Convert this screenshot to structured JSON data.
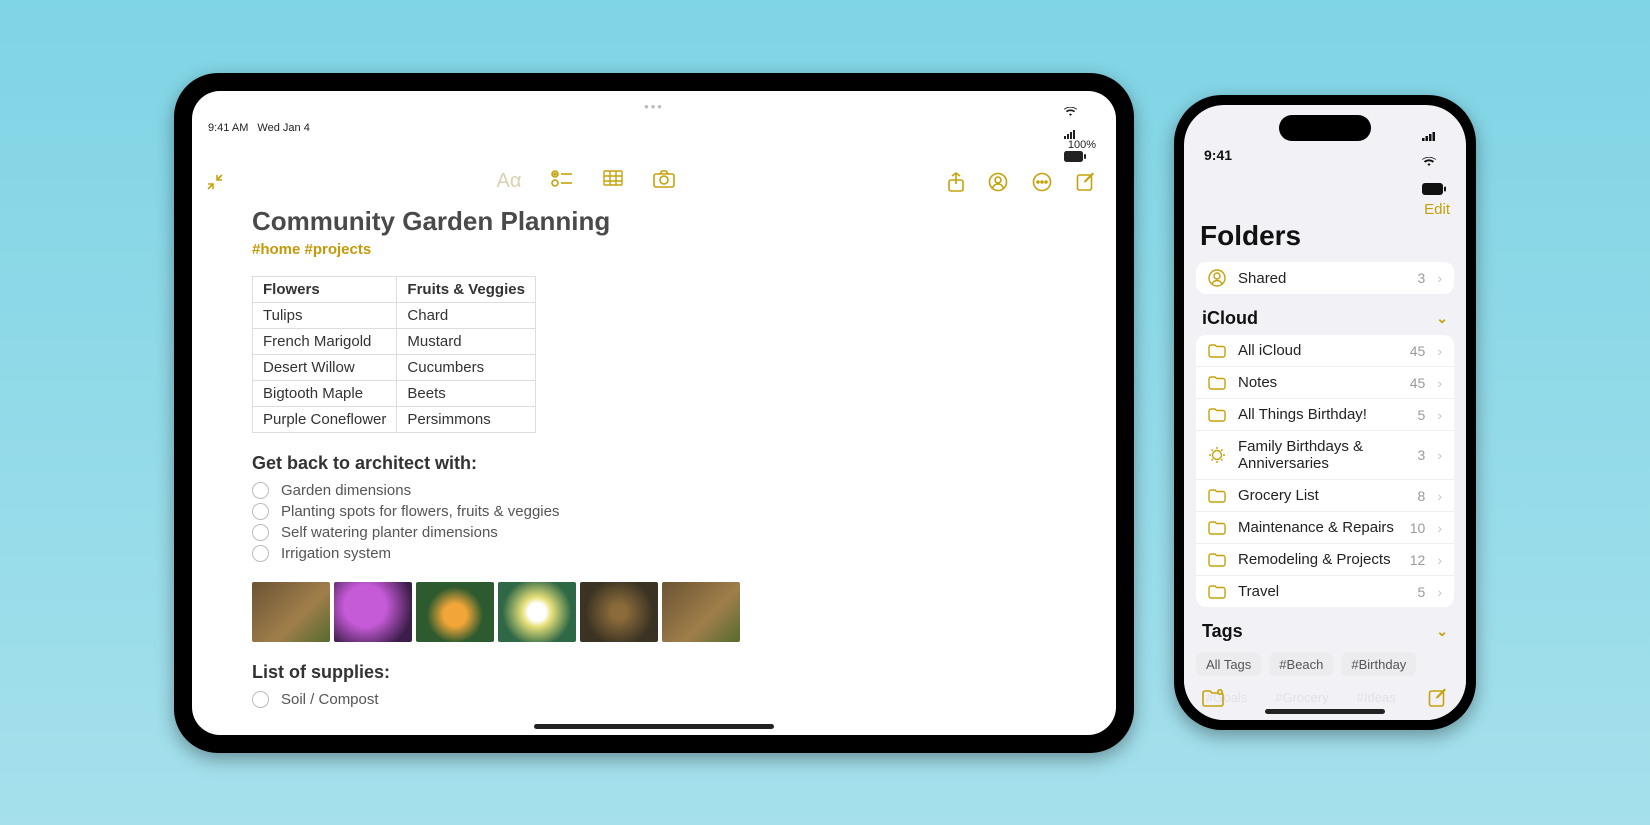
{
  "ipad": {
    "status": {
      "time": "9:41 AM",
      "date": "Wed Jan 4",
      "battery": "100%"
    },
    "note": {
      "title": "Community Garden Planning",
      "tags": "#home #projects",
      "table": {
        "headers": [
          "Flowers",
          "Fruits & Veggies"
        ],
        "rows": [
          [
            "Tulips",
            "Chard"
          ],
          [
            "French Marigold",
            "Mustard"
          ],
          [
            "Desert Willow",
            "Cucumbers"
          ],
          [
            "Bigtooth Maple",
            "Beets"
          ],
          [
            "Purple Coneflower",
            "Persimmons"
          ]
        ]
      },
      "architect_heading": "Get back to architect with:",
      "architect_items": [
        "Garden dimensions",
        "Planting spots for flowers, fruits & veggies",
        "Self watering planter dimensions",
        "Irrigation system"
      ],
      "supplies_heading": "List of supplies:",
      "supplies_items": [
        "Soil / Compost"
      ]
    }
  },
  "iphone": {
    "status": {
      "time": "9:41"
    },
    "edit": "Edit",
    "title": "Folders",
    "shared": {
      "label": "Shared",
      "count": "3"
    },
    "icloud_section": "iCloud",
    "folders": [
      {
        "icon": "folder",
        "label": "All iCloud",
        "count": "45"
      },
      {
        "icon": "folder",
        "label": "Notes",
        "count": "45"
      },
      {
        "icon": "folder",
        "label": "All Things Birthday!",
        "count": "5"
      },
      {
        "icon": "smart",
        "label": "Family Birthdays & Anniversaries",
        "count": "3"
      },
      {
        "icon": "folder",
        "label": "Grocery List",
        "count": "8"
      },
      {
        "icon": "folder",
        "label": "Maintenance & Repairs",
        "count": "10"
      },
      {
        "icon": "folder",
        "label": "Remodeling & Projects",
        "count": "12"
      },
      {
        "icon": "folder",
        "label": "Travel",
        "count": "5"
      }
    ],
    "tags_section": "Tags",
    "tags": [
      "All Tags",
      "#Beach",
      "#Birthday",
      "#Goals",
      "#Grocery",
      "#Ideas"
    ]
  }
}
